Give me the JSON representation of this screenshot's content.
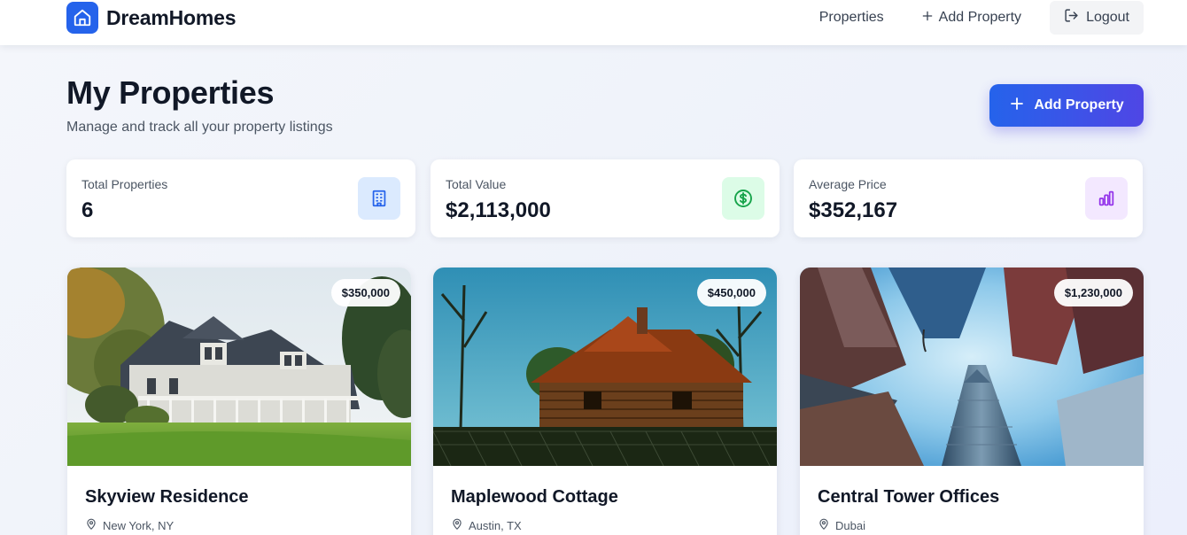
{
  "brand": {
    "name": "DreamHomes",
    "icon": "home-icon",
    "color": "#2563eb"
  },
  "nav": {
    "properties": "Properties",
    "add_property": "Add Property",
    "logout": "Logout"
  },
  "header": {
    "title": "My Properties",
    "subtitle": "Manage and track all your property listings",
    "add_button": "Add Property"
  },
  "stats": [
    {
      "label": "Total Properties",
      "value": "6",
      "icon": "building-icon",
      "color": "#2563eb"
    },
    {
      "label": "Total Value",
      "value": "$2,113,000",
      "icon": "dollar-icon",
      "color": "#16a34a"
    },
    {
      "label": "Average Price",
      "value": "$352,167",
      "icon": "bar-chart-icon",
      "color": "#9333ea"
    }
  ],
  "properties": [
    {
      "name": "Skyview Residence",
      "location": "New York, NY",
      "price": "$350,000"
    },
    {
      "name": "Maplewood Cottage",
      "location": "Austin, TX",
      "price": "$450,000"
    },
    {
      "name": "Central Tower Offices",
      "location": "Dubai",
      "price": "$1,230,000"
    }
  ],
  "colors": {
    "accent_start": "#2563eb",
    "accent_end": "#4f46e5",
    "text_primary": "#111827",
    "text_secondary": "#4b5563"
  }
}
